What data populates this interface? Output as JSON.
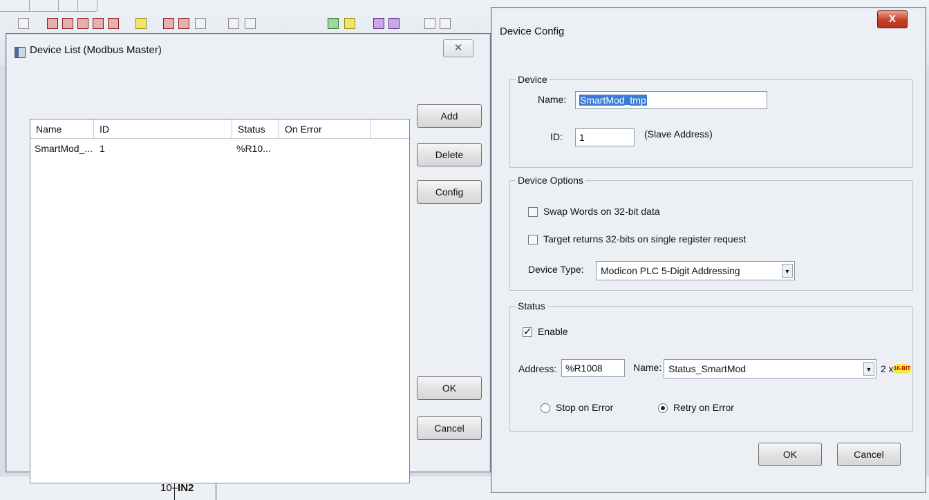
{
  "background": {
    "rung_number": "10",
    "rung_element": "IN2"
  },
  "device_list": {
    "title": "Device List (Modbus Master)",
    "close_label": "✕",
    "columns": [
      "Name",
      "ID",
      "Status",
      "On Error"
    ],
    "rows": [
      {
        "name": "SmartMod_...",
        "id": "1",
        "status": "%R10...",
        "on_error": ""
      }
    ],
    "buttons": {
      "add": "Add",
      "delete": "Delete",
      "config": "Config",
      "ok": "OK",
      "cancel": "Cancel"
    }
  },
  "device_config": {
    "title": "Device Config",
    "close_label": "X",
    "device": {
      "group_title": "Device",
      "name_label": "Name:",
      "name_value": "SmartMod_tmp",
      "id_label": "ID:",
      "id_value": "1",
      "id_hint": "(Slave Address)"
    },
    "options": {
      "group_title": "Device Options",
      "swap_words_label": "Swap Words on 32-bit data",
      "swap_words_checked": false,
      "target_returns_label": "Target returns 32-bits on single register request",
      "target_returns_checked": false,
      "device_type_label": "Device Type:",
      "device_type_value": "Modicon PLC 5-Digit Addressing"
    },
    "status": {
      "group_title": "Status",
      "enable_label": "Enable",
      "enable_checked": true,
      "address_label": "Address:",
      "address_value": "%R1008",
      "name_label": "Name:",
      "name_value": "Status_SmartMod",
      "size_label": "2 x",
      "size_badge": "16-BIT",
      "stop_on_error_label": "Stop on Error",
      "retry_on_error_label": "Retry on Error",
      "selected_mode": "retry"
    },
    "buttons": {
      "ok": "OK",
      "cancel": "Cancel"
    }
  }
}
